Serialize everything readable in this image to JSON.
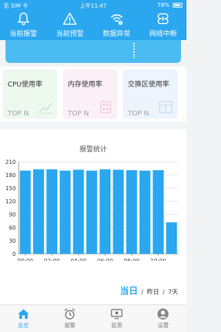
{
  "status_bar": {
    "carrier": "无 SIM 卡",
    "time": "上午11:47",
    "battery": "78%",
    "battery_level": 0.78
  },
  "top_nav": [
    {
      "label": "当前报警",
      "icon": "bell-icon"
    },
    {
      "label": "当前预警",
      "icon": "warning-icon"
    },
    {
      "label": "数据异常",
      "icon": "wifi-alert-icon"
    },
    {
      "label": "网络中断",
      "icon": "network-break-icon"
    }
  ],
  "cards": [
    {
      "title": "CPU使用率",
      "sub": "TOP N",
      "icon": "chart-line-icon"
    },
    {
      "title": "内存使用率",
      "sub": "TOP N",
      "icon": "memory-icon"
    },
    {
      "title": "交换区使用率",
      "sub": "TOP N",
      "icon": "window-icon"
    }
  ],
  "chart_title": "报警统计",
  "chart_data": {
    "type": "bar",
    "title": "报警统计",
    "y_ticks": [
      "0",
      "30",
      "60",
      "90",
      "120",
      "150",
      "180",
      "210"
    ],
    "ylim": [
      0,
      210
    ],
    "x_tick_labels": [
      "00:00",
      "02:00",
      "04:00",
      "06:00",
      "08:00",
      "10:00"
    ],
    "x_tick_positions": [
      0,
      2,
      4,
      6,
      8,
      10
    ],
    "values": [
      190,
      193,
      193,
      190,
      192,
      190,
      193,
      192,
      191,
      190,
      191,
      72
    ],
    "color": "#2aa7ef",
    "grid": true
  },
  "range": {
    "active": "当日",
    "sep": "/",
    "opt1": "昨日",
    "opt2": "7天"
  },
  "tabs": [
    {
      "label": "总览",
      "icon": "home-icon"
    },
    {
      "label": "报警",
      "icon": "alarm-clock-icon"
    },
    {
      "label": "监测",
      "icon": "monitor-icon"
    },
    {
      "label": "设置",
      "icon": "user-icon"
    }
  ],
  "colors": {
    "primary": "#2aa7ef",
    "banner": "#4bbcf2",
    "card1": "#edf8ef",
    "card2": "#fbf0f6",
    "card3": "#eef4fb"
  }
}
